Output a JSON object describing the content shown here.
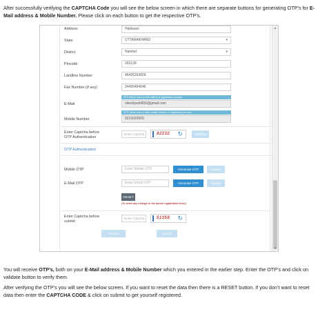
{
  "intro": {
    "t1": "After successfully verifying the ",
    "b1": "CAPTCHA Code",
    "t2": " you will  see the below screen in which there are separate buttons for generating OTP’s for ",
    "b2": "E-Mail address & Mobile Number.",
    "t3": " Please click on each button to get the respective OTP’s."
  },
  "form": {
    "address": {
      "label": "Address",
      "value": "Haldwani"
    },
    "state": {
      "label": "State",
      "value": "UTTARAKHAND"
    },
    "district": {
      "label": "District",
      "value": "Nainital"
    },
    "pincode": {
      "label": "Pincode",
      "value": "263139"
    },
    "landline": {
      "label": "Landline Number",
      "value": "46426263659"
    },
    "fax": {
      "label": "Fax Number (If any)",
      "value": "24465464646"
    },
    "email": {
      "label": "E-Mail",
      "hint": "OTP will be sent on this mail id in registration process",
      "value": "niteshjoshi655@gmail.com"
    },
    "mobile": {
      "label": "Mobile Number",
      "hint": "OTP will be sent on this mobile number in registration process",
      "value": "9210020509"
    },
    "captcha1": {
      "label_line1": "Enter Captcha before",
      "label_line2": "OTP Authentication",
      "placeholder": "Enter Captcha",
      "code": "82232",
      "validate_label": "Validate"
    }
  },
  "otp": {
    "title": "OTP Authentication",
    "mobile": {
      "label": "Mobile OTP",
      "placeholder": "Enter Mobile OTP",
      "generate_label": "Generate OTP",
      "validate_label": "Validate"
    },
    "email": {
      "label": "E-Mail OTP",
      "placeholder": "Enter Email OTP",
      "generate_label": "Generate OTP",
      "validate_label": "Validate"
    },
    "reset_label": "RESET",
    "reset_note": "(To reset any change in the above registration form)"
  },
  "submit_section": {
    "label_line1": "Enter Captcha before",
    "label_line2": "submit",
    "placeholder": "Enter Captcha",
    "code": "51358",
    "cancel_label": "Cancel",
    "submit_label": "Submit"
  },
  "outro1": {
    "t1": "You will receive ",
    "b1": "OTP’s,",
    "t2": " both on your ",
    "b2": "E-Mail address & Mobile Number",
    "t3": " which you entered in the earlier step. Enter the OTP’s and click on validate button to verify them."
  },
  "outro2": {
    "t1": "After verifying the OTP’s you will see the below screen. If you want to reset the data then there is a RESET button. If you don’t want to reset data then enter the ",
    "b1": "CAPTCHA CODE",
    "t2": " & click on submit to get yourself registered."
  },
  "colors": {
    "primary_button": "#2f8fd0",
    "captcha_text": "#c83b3b",
    "hint_bar": "#6fb8d8"
  }
}
